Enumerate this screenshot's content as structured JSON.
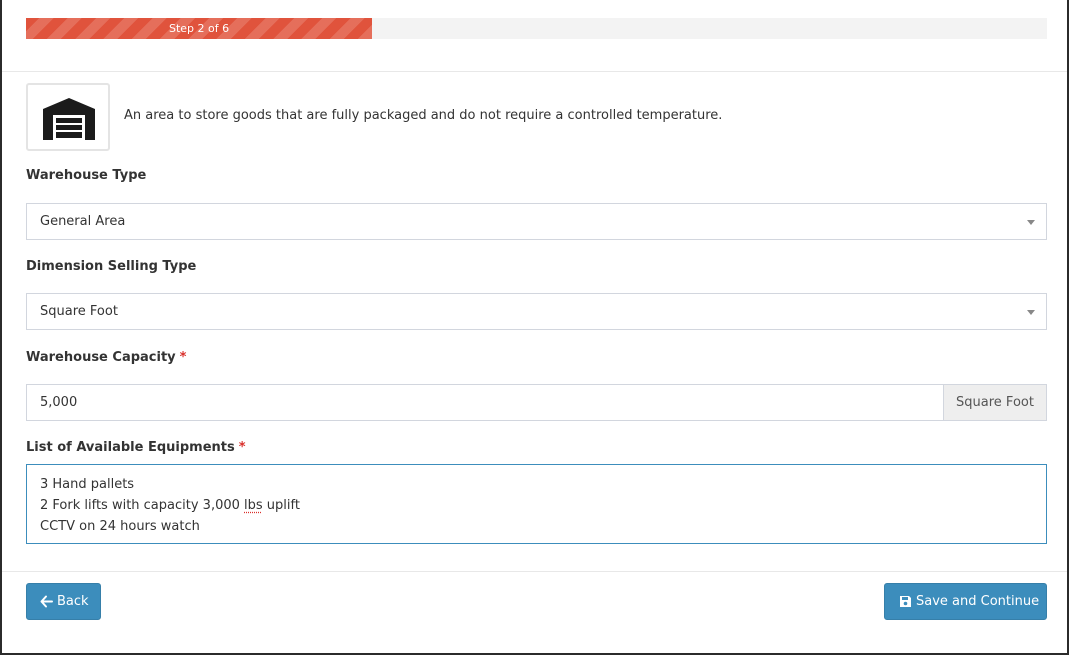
{
  "progress": {
    "label": "Step 2 of 6",
    "current_step": 2,
    "total_steps": 6,
    "fill_percent": 33.9,
    "color": "#e0533c"
  },
  "warehouse_type_info": {
    "icon": "warehouse-icon",
    "description": "An area to store goods that are fully packaged and do not require a controlled temperature."
  },
  "form": {
    "warehouse_type": {
      "label": "Warehouse Type",
      "value": "General Area"
    },
    "dimension_selling_type": {
      "label": "Dimension Selling Type",
      "value": "Square Foot"
    },
    "warehouse_capacity": {
      "label": "Warehouse Capacity",
      "required_mark": "*",
      "value": "5,000",
      "unit": "Square Foot"
    },
    "equipments": {
      "label": "List of Available Equipments",
      "required_mark": "*",
      "lines": [
        "3 Hand pallets",
        "2 Fork lifts with capacity 3,000 lbs uplift",
        "CCTV on 24 hours watch"
      ]
    }
  },
  "actions": {
    "back_label": "Back",
    "back_icon": "arrow-left-icon",
    "save_label": "Save and Continue",
    "save_icon": "floppy-disk-icon"
  },
  "colors": {
    "primary_button": "#3c8dbc",
    "required": "#d9302c"
  }
}
